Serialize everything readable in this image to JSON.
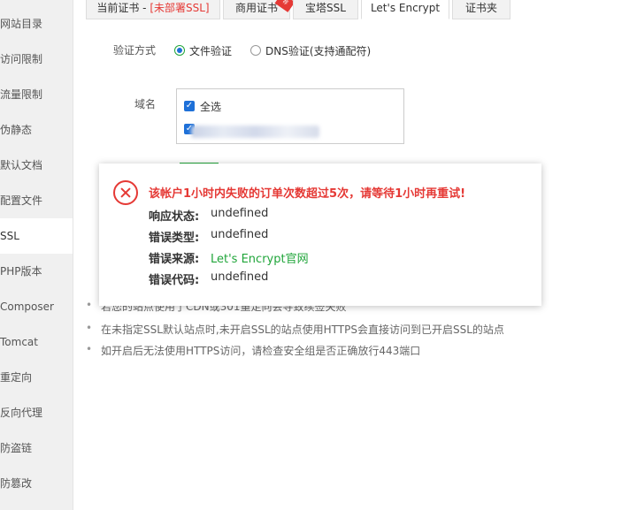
{
  "sidebar": {
    "items": [
      {
        "label": "网站目录"
      },
      {
        "label": "访问限制"
      },
      {
        "label": "流量限制"
      },
      {
        "label": "伪静态"
      },
      {
        "label": "默认文档"
      },
      {
        "label": "配置文件"
      },
      {
        "label": "SSL",
        "active": true
      },
      {
        "label": "PHP版本"
      },
      {
        "label": "Composer"
      },
      {
        "label": "Tomcat"
      },
      {
        "label": "重定向"
      },
      {
        "label": "反向代理"
      },
      {
        "label": "防盗链"
      },
      {
        "label": "防篡改"
      }
    ]
  },
  "tabs": {
    "current_prefix": "当前证书 - ",
    "current_status": "[未部署SSL]",
    "commercial": "商用证书",
    "ribbon": "荐",
    "baota": "宝塔SSL",
    "letsencrypt": "Let's Encrypt",
    "folder": "证书夹"
  },
  "form": {
    "verify_label": "验证方式",
    "option_file": "文件验证",
    "option_dns": "DNS验证(支持通配符)",
    "domain_label": "域名",
    "select_all": "全选"
  },
  "notes": [
    "若您的站点使用了CDN或301重定向会导致续签失败",
    "在未指定SSL默认站点时,未开启SSL的站点使用HTTPS会直接访问到已开启SSL的站点",
    "如开启后无法使用HTTPS访问，请检查安全组是否正确放行443端口"
  ],
  "dialog": {
    "icon": "error-circle-icon",
    "title": "该帐户1小时内失败的订单次数超过5次，请等待1小时再重试!",
    "rows": [
      {
        "label": "响应状态:",
        "value": "undefined"
      },
      {
        "label": "错误类型:",
        "value": "undefined"
      },
      {
        "label": "错误来源:",
        "value": "Let's Encrypt官网"
      },
      {
        "label": "错误代码:",
        "value": "undefined"
      }
    ]
  },
  "colors": {
    "error": "#e53935",
    "accent_green": "#20a53a",
    "checkbox_blue": "#1e70d8"
  }
}
